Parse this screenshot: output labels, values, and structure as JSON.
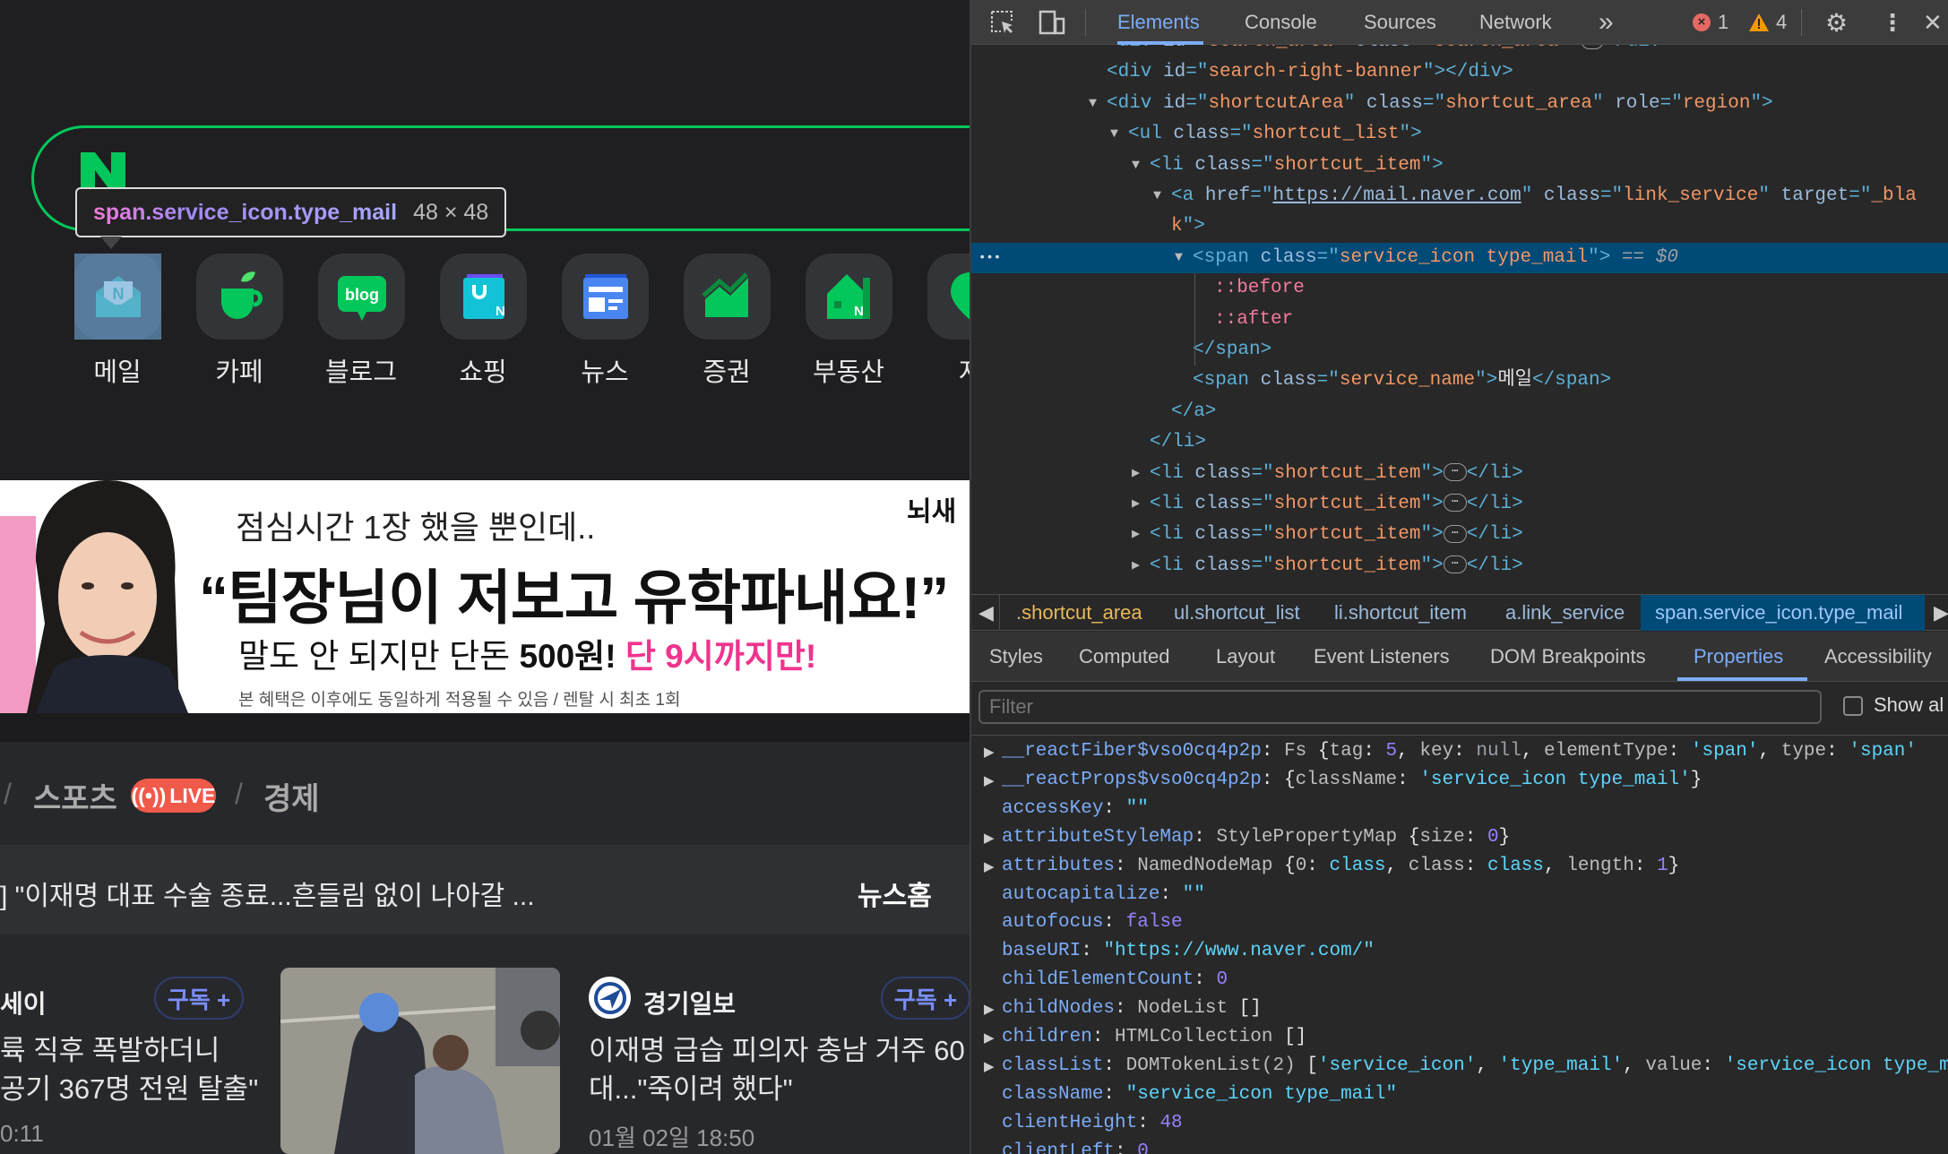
{
  "page": {
    "tooltip": {
      "selector": "span.service_icon.type_mail",
      "size": "48 × 48"
    },
    "services": [
      {
        "label": "메일",
        "icon": "mail-icon"
      },
      {
        "label": "카페",
        "icon": "cafe-cup-icon"
      },
      {
        "label": "블로그",
        "icon": "blog-icon"
      },
      {
        "label": "쇼핑",
        "icon": "shopping-bag-icon"
      },
      {
        "label": "뉴스",
        "icon": "news-icon"
      },
      {
        "label": "증권",
        "icon": "stock-chart-icon"
      },
      {
        "label": "부동산",
        "icon": "real-estate-house-icon"
      },
      {
        "label": "지",
        "icon": "map-pin-icon"
      }
    ],
    "banner": {
      "line1": "점심시간 1장 했을 뿐인데..",
      "headline": "“팀장님이 저보고 유학파내요!”",
      "line3_a": "말도 안 되지만  단돈 ",
      "line3_b": "500원!",
      "line3_c": " 단 9시까지만!",
      "fineprint": "본 혜택은 이후에도 동일하게 적용될 수 있음 / 렌탈 시 최초 1회",
      "brand": "뇌새"
    },
    "news_nav": {
      "sep": "/",
      "tab_sports": "스포츠",
      "live": "LIVE",
      "tab_economy": "경제"
    },
    "headline": {
      "text": "] \"이재명 대표 수술 종료...흔들림 없이 나아갈 ...",
      "news_home": "뉴스홈"
    },
    "cards": [
      {
        "press": "세이",
        "subscribe": "구독 +",
        "title1": "륙 직후 폭발하더니",
        "title2": "공기 367명 전원 탈출\"",
        "time": "0:11"
      },
      {
        "press": "경기일보",
        "subscribe": "구독 +",
        "title1": "이재명 급습 피의자 충남 거주 60",
        "title2": "대...\"죽이려 했다\"",
        "time": "01월 02일 18:50"
      }
    ]
  },
  "devtools": {
    "tabs": [
      "Elements",
      "Console",
      "Sources",
      "Network"
    ],
    "more_tabs": "»",
    "errors": "1",
    "warnings": "4",
    "tree": [
      {
        "depth": 0,
        "arrow": "",
        "tokens": [
          [
            "tag",
            "<div "
          ],
          [
            "attr",
            "id"
          ],
          [
            "tag",
            "=\""
          ],
          [
            "val",
            "search_area"
          ],
          [
            "tag",
            "\" "
          ],
          [
            "attr",
            "class"
          ],
          [
            "tag",
            "=\""
          ],
          [
            "val",
            "search_area"
          ],
          [
            "tag",
            "\">"
          ],
          [
            "ell",
            "⋯"
          ],
          [
            "tag",
            "</div>"
          ]
        ]
      },
      {
        "depth": 0,
        "arrow": "",
        "tokens": [
          [
            "tag",
            "<div "
          ],
          [
            "attr",
            "id"
          ],
          [
            "tag",
            "=\""
          ],
          [
            "val",
            "search-right-banner"
          ],
          [
            "tag",
            "\"></div>"
          ]
        ]
      },
      {
        "depth": 0,
        "arrow": "open",
        "tokens": [
          [
            "tag",
            "<div "
          ],
          [
            "attr",
            "id"
          ],
          [
            "tag",
            "=\""
          ],
          [
            "val",
            "shortcutArea"
          ],
          [
            "tag",
            "\" "
          ],
          [
            "attr",
            "class"
          ],
          [
            "tag",
            "=\""
          ],
          [
            "val",
            "shortcut_area"
          ],
          [
            "tag",
            "\" "
          ],
          [
            "attr",
            "role"
          ],
          [
            "tag",
            "=\""
          ],
          [
            "val",
            "region"
          ],
          [
            "tag",
            "\">"
          ]
        ]
      },
      {
        "depth": 1,
        "arrow": "open",
        "tokens": [
          [
            "tag",
            "<ul "
          ],
          [
            "attr",
            "class"
          ],
          [
            "tag",
            "=\""
          ],
          [
            "val",
            "shortcut_list"
          ],
          [
            "tag",
            "\">"
          ]
        ]
      },
      {
        "depth": 2,
        "arrow": "open",
        "tokens": [
          [
            "tag",
            "<li "
          ],
          [
            "attr",
            "class"
          ],
          [
            "tag",
            "=\""
          ],
          [
            "val",
            "shortcut_item"
          ],
          [
            "tag",
            "\">"
          ]
        ]
      },
      {
        "depth": 3,
        "arrow": "open",
        "tokens": [
          [
            "tag",
            "<a "
          ],
          [
            "attr",
            "href"
          ],
          [
            "tag",
            "=\""
          ],
          [
            "link",
            "https://mail.naver.com"
          ],
          [
            "tag",
            "\" "
          ],
          [
            "attr",
            "class"
          ],
          [
            "tag",
            "=\""
          ],
          [
            "val",
            "link_service"
          ],
          [
            "tag",
            "\" "
          ],
          [
            "attr",
            "target"
          ],
          [
            "tag",
            "=\""
          ],
          [
            "val",
            "_bla"
          ]
        ]
      },
      {
        "depth": 3,
        "arrow": "",
        "tokens": [
          [
            "val",
            "k"
          ],
          [
            "tag",
            "\">"
          ]
        ]
      },
      {
        "depth": 4,
        "arrow": "open",
        "selected": true,
        "tokens": [
          [
            "tag",
            "<span "
          ],
          [
            "attr",
            "class"
          ],
          [
            "tag",
            "=\""
          ],
          [
            "val",
            "service_icon type_mail"
          ],
          [
            "tag",
            "\">"
          ],
          [
            "eq",
            " == $0"
          ]
        ]
      },
      {
        "depth": 5,
        "arrow": "",
        "tokens": [
          [
            "pseudo",
            "::before"
          ]
        ]
      },
      {
        "depth": 5,
        "arrow": "",
        "tokens": [
          [
            "pseudo",
            "::after"
          ]
        ]
      },
      {
        "depth": 4,
        "arrow": "",
        "tokens": [
          [
            "tag",
            "</span>"
          ]
        ]
      },
      {
        "depth": 4,
        "arrow": "",
        "tokens": [
          [
            "tag",
            "<span "
          ],
          [
            "attr",
            "class"
          ],
          [
            "tag",
            "=\""
          ],
          [
            "val",
            "service_name"
          ],
          [
            "tag",
            "\">"
          ],
          [
            "text",
            "메일"
          ],
          [
            "tag",
            "</span>"
          ]
        ]
      },
      {
        "depth": 3,
        "arrow": "",
        "tokens": [
          [
            "tag",
            "</a>"
          ]
        ]
      },
      {
        "depth": 2,
        "arrow": "",
        "tokens": [
          [
            "tag",
            "</li>"
          ]
        ]
      },
      {
        "depth": 2,
        "arrow": "closed",
        "tokens": [
          [
            "tag",
            "<li "
          ],
          [
            "attr",
            "class"
          ],
          [
            "tag",
            "=\""
          ],
          [
            "val",
            "shortcut_item"
          ],
          [
            "tag",
            "\">"
          ],
          [
            "ell",
            "⋯"
          ],
          [
            "tag",
            "</li>"
          ]
        ]
      },
      {
        "depth": 2,
        "arrow": "closed",
        "tokens": [
          [
            "tag",
            "<li "
          ],
          [
            "attr",
            "class"
          ],
          [
            "tag",
            "=\""
          ],
          [
            "val",
            "shortcut_item"
          ],
          [
            "tag",
            "\">"
          ],
          [
            "ell",
            "⋯"
          ],
          [
            "tag",
            "</li>"
          ]
        ]
      },
      {
        "depth": 2,
        "arrow": "closed",
        "tokens": [
          [
            "tag",
            "<li "
          ],
          [
            "attr",
            "class"
          ],
          [
            "tag",
            "=\""
          ],
          [
            "val",
            "shortcut_item"
          ],
          [
            "tag",
            "\">"
          ],
          [
            "ell",
            "⋯"
          ],
          [
            "tag",
            "</li>"
          ]
        ]
      },
      {
        "depth": 2,
        "arrow": "closed",
        "tokens": [
          [
            "tag",
            "<li "
          ],
          [
            "attr",
            "class"
          ],
          [
            "tag",
            "=\""
          ],
          [
            "val",
            "shortcut_item"
          ],
          [
            "tag",
            "\">"
          ],
          [
            "ell",
            "⋯"
          ],
          [
            "tag",
            "</li>"
          ]
        ]
      }
    ],
    "selected_marker": "•••",
    "breadcrumbs": [
      ".shortcut_area",
      "ul.shortcut_list",
      "li.shortcut_item",
      "a.link_service",
      "span.service_icon.type_mail"
    ],
    "sidebar_tabs": [
      "Styles",
      "Computed",
      "Layout",
      "Event Listeners",
      "DOM Breakpoints",
      "Properties",
      "Accessibility"
    ],
    "filter_placeholder": "Filter",
    "show_all": "Show al",
    "properties": [
      {
        "arrow": true,
        "tokens": [
          [
            "key",
            "__reactFiber$vso0cq4p2p"
          ],
          [
            "punct",
            ": "
          ],
          [
            "cls",
            "Fs "
          ],
          [
            "punct",
            "{"
          ],
          [
            "cls",
            "tag"
          ],
          [
            "punct",
            ": "
          ],
          [
            "num",
            "5"
          ],
          [
            "punct",
            ", "
          ],
          [
            "cls",
            "key"
          ],
          [
            "punct",
            ": "
          ],
          [
            "null",
            "null"
          ],
          [
            "punct",
            ", "
          ],
          [
            "cls",
            "elementType"
          ],
          [
            "punct",
            ": "
          ],
          [
            "str",
            "'span'"
          ],
          [
            "punct",
            ", "
          ],
          [
            "cls",
            "type"
          ],
          [
            "punct",
            ": "
          ],
          [
            "str",
            "'span'"
          ]
        ]
      },
      {
        "arrow": true,
        "tokens": [
          [
            "key",
            "__reactProps$vso0cq4p2p"
          ],
          [
            "punct",
            ": {"
          ],
          [
            "cls",
            "className"
          ],
          [
            "punct",
            ": "
          ],
          [
            "str",
            "'service_icon type_mail'"
          ],
          [
            "punct",
            "}"
          ]
        ]
      },
      {
        "arrow": false,
        "tokens": [
          [
            "key",
            "accessKey"
          ],
          [
            "punct",
            ": "
          ],
          [
            "dstr",
            "\"\""
          ]
        ]
      },
      {
        "arrow": true,
        "tokens": [
          [
            "key",
            "attributeStyleMap"
          ],
          [
            "punct",
            ": "
          ],
          [
            "cls",
            "StylePropertyMap "
          ],
          [
            "punct",
            "{"
          ],
          [
            "cls",
            "size"
          ],
          [
            "punct",
            ": "
          ],
          [
            "num",
            "0"
          ],
          [
            "punct",
            "}"
          ]
        ]
      },
      {
        "arrow": true,
        "tokens": [
          [
            "key",
            "attributes"
          ],
          [
            "punct",
            ": "
          ],
          [
            "cls",
            "NamedNodeMap "
          ],
          [
            "punct",
            "{"
          ],
          [
            "cls",
            "0"
          ],
          [
            "punct",
            ": "
          ],
          [
            "str",
            "class"
          ],
          [
            "punct",
            ", "
          ],
          [
            "cls",
            "class"
          ],
          [
            "punct",
            ": "
          ],
          [
            "str",
            "class"
          ],
          [
            "punct",
            ", "
          ],
          [
            "cls",
            "length"
          ],
          [
            "punct",
            ": "
          ],
          [
            "num",
            "1"
          ],
          [
            "punct",
            "}"
          ]
        ]
      },
      {
        "arrow": false,
        "tokens": [
          [
            "key",
            "autocapitalize"
          ],
          [
            "punct",
            ": "
          ],
          [
            "dstr",
            "\"\""
          ]
        ]
      },
      {
        "arrow": false,
        "tokens": [
          [
            "key",
            "autofocus"
          ],
          [
            "punct",
            ": "
          ],
          [
            "kw",
            "false"
          ]
        ]
      },
      {
        "arrow": false,
        "tokens": [
          [
            "key",
            "baseURI"
          ],
          [
            "punct",
            ": "
          ],
          [
            "dstr",
            "\"https://www.naver.com/\""
          ]
        ]
      },
      {
        "arrow": false,
        "tokens": [
          [
            "key",
            "childElementCount"
          ],
          [
            "punct",
            ": "
          ],
          [
            "num",
            "0"
          ]
        ]
      },
      {
        "arrow": true,
        "tokens": [
          [
            "key",
            "childNodes"
          ],
          [
            "punct",
            ": "
          ],
          [
            "cls",
            "NodeList "
          ],
          [
            "punct",
            "[]"
          ]
        ]
      },
      {
        "arrow": true,
        "tokens": [
          [
            "key",
            "children"
          ],
          [
            "punct",
            ": "
          ],
          [
            "cls",
            "HTMLCollection "
          ],
          [
            "punct",
            "[]"
          ]
        ]
      },
      {
        "arrow": true,
        "tokens": [
          [
            "key",
            "classList"
          ],
          [
            "punct",
            ": "
          ],
          [
            "cls",
            "DOMTokenList(2) "
          ],
          [
            "punct",
            "["
          ],
          [
            "str",
            "'service_icon'"
          ],
          [
            "punct",
            ", "
          ],
          [
            "str",
            "'type_mail'"
          ],
          [
            "punct",
            ", "
          ],
          [
            "cls",
            "value"
          ],
          [
            "punct",
            ": "
          ],
          [
            "str",
            "'service_icon type_mail'"
          ]
        ]
      },
      {
        "arrow": false,
        "tokens": [
          [
            "key",
            "className"
          ],
          [
            "punct",
            ": "
          ],
          [
            "dstr",
            "\"service_icon type_mail\""
          ]
        ]
      },
      {
        "arrow": false,
        "tokens": [
          [
            "key",
            "clientHeight"
          ],
          [
            "punct",
            ": "
          ],
          [
            "num",
            "48"
          ]
        ]
      },
      {
        "arrow": false,
        "tokens": [
          [
            "key",
            "clientLeft"
          ],
          [
            "punct",
            ": "
          ],
          [
            "num",
            "0"
          ]
        ]
      }
    ]
  }
}
